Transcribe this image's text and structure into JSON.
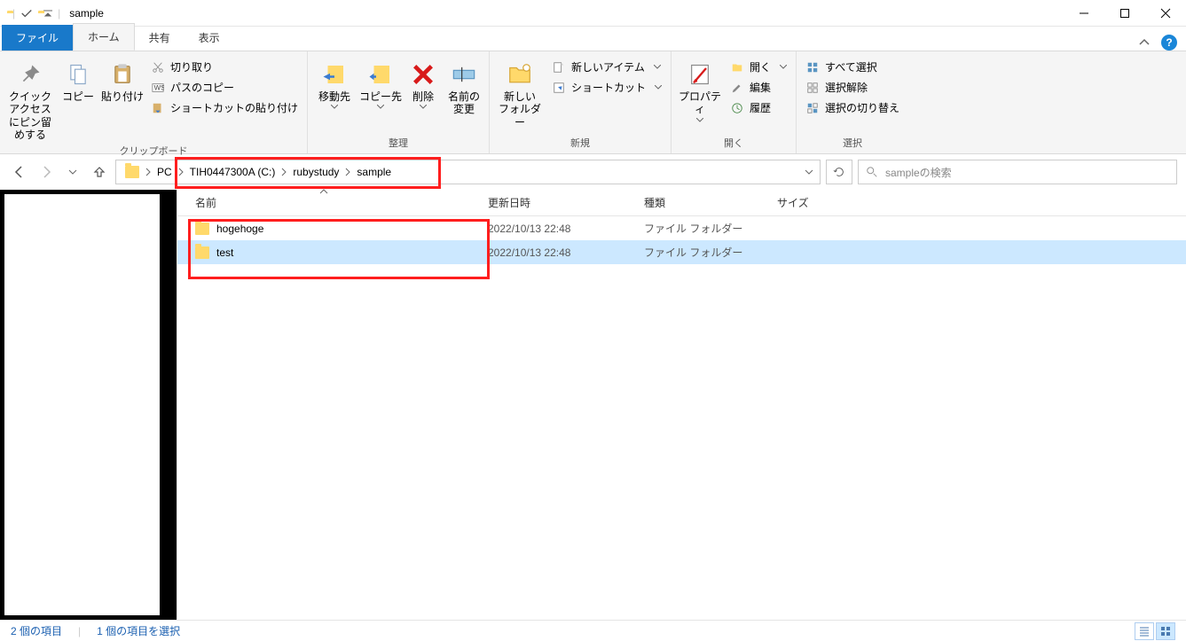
{
  "window": {
    "title": "sample"
  },
  "tabs": {
    "file": "ファイル",
    "home": "ホーム",
    "share": "共有",
    "view": "表示"
  },
  "ribbon": {
    "clipboard": {
      "label": "クリップボード",
      "pin": "クイック アクセス\nにピン留めする",
      "copy": "コピー",
      "paste": "貼り付け",
      "cut": "切り取り",
      "copy_path": "パスのコピー",
      "paste_shortcut": "ショートカットの貼り付け"
    },
    "organize": {
      "label": "整理",
      "move": "移動先",
      "copy_to": "コピー先",
      "delete": "削除",
      "rename": "名前の\n変更"
    },
    "new": {
      "label": "新規",
      "new_folder": "新しい\nフォルダー",
      "new_item": "新しいアイテム",
      "shortcut": "ショートカット"
    },
    "open": {
      "label": "開く",
      "properties": "プロパティ",
      "open": "開く",
      "edit": "編集",
      "history": "履歴"
    },
    "select": {
      "label": "選択",
      "select_all": "すべて選択",
      "select_none": "選択解除",
      "invert": "選択の切り替え"
    }
  },
  "breadcrumb": {
    "pc": "PC",
    "drive": "TIH0447300A (C:)",
    "folder1": "rubystudy",
    "folder2": "sample"
  },
  "search": {
    "placeholder": "sampleの検索"
  },
  "columns": {
    "name": "名前",
    "modified": "更新日時",
    "type": "種類",
    "size": "サイズ"
  },
  "items": [
    {
      "name": "hogehoge",
      "modified": "2022/10/13 22:48",
      "type": "ファイル フォルダー",
      "size": "",
      "selected": false
    },
    {
      "name": "test",
      "modified": "2022/10/13 22:48",
      "type": "ファイル フォルダー",
      "size": "",
      "selected": true
    }
  ],
  "status": {
    "count": "2 個の項目",
    "selected": "1 個の項目を選択"
  }
}
